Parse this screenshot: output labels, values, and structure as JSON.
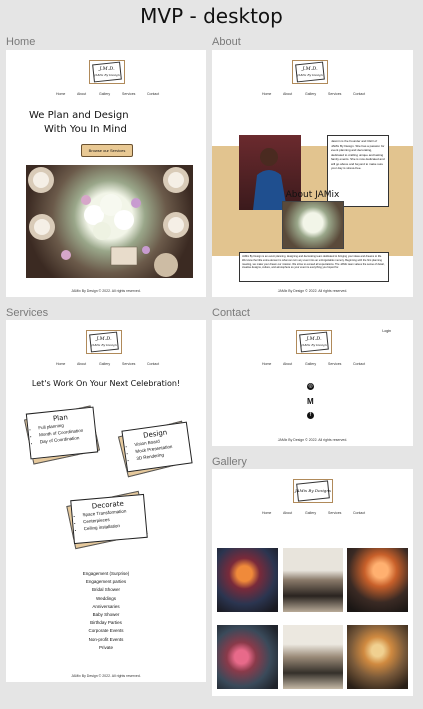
{
  "page_title": "MVP - desktop",
  "nav_items": [
    "Home",
    "About",
    "Gallery",
    "Services",
    "Contact"
  ],
  "logo": {
    "letters": "J.M.D.",
    "line2": "JAMix By Design",
    "gallery_text": "JAMix By Designs"
  },
  "footer": "JAMix By Design © 2022. All rights reserved.",
  "home": {
    "label": "Home",
    "heading_line1": "We Plan and Design",
    "heading_line2": "With You In Mind",
    "cta": "Browse our Services"
  },
  "about": {
    "label": "About",
    "bio": "Jasmin is the Founder and CEO of JAMix By Design. She has a passion for event planning and decorating, dedicated to crafting unique and lasting family events. She is now dedicated and will go above and beyond to make sure your day is stress-free.",
    "heading": "About JAMix",
    "body": "JAMix By Design is an event planning, designing and decorating team dedicated to bringing your ideas and dreams to life. We know the little extra element is what can turn any event into an unforgettable memory. Beginning with the first planning meeting, we make your dream our mission. We strive to exceed all expectations. The JAMix team values the sense of detail, creative designs, culture, and atmosphere so your event is everything you hoped for."
  },
  "services": {
    "label": "Services",
    "heading": "Let's Work On Your Next Celebration!",
    "plan": {
      "title": "Plan",
      "items": [
        "Full planning",
        "Month of Coordination",
        "Day of Coordination"
      ]
    },
    "design": {
      "title": "Design",
      "items": [
        "Vision Board",
        "Mock Presentation",
        "3D Rendering"
      ]
    },
    "decorate": {
      "title": "Decorate",
      "items": [
        "Space Transformation",
        "Centerpieces",
        "Ceiling installation"
      ]
    },
    "events": [
      "Engagement (Surprise)",
      "Engagement parties",
      "Bridal Shower",
      "Weddings",
      "Anniversaries",
      "Baby Shower",
      "Birthday Parties",
      "Corporate Events",
      "Non-profit Events",
      "Private"
    ]
  },
  "contact": {
    "label": "Contact",
    "login": "Login",
    "icons": [
      "instagram-icon",
      "gmail-icon",
      "facebook-icon"
    ]
  },
  "gallery": {
    "label": "Gallery"
  },
  "colors": {
    "accent": "#e2c48f",
    "cta_bg": "#e9c994",
    "cta_border": "#6b5231",
    "page_bg": "#e5e5e5"
  }
}
